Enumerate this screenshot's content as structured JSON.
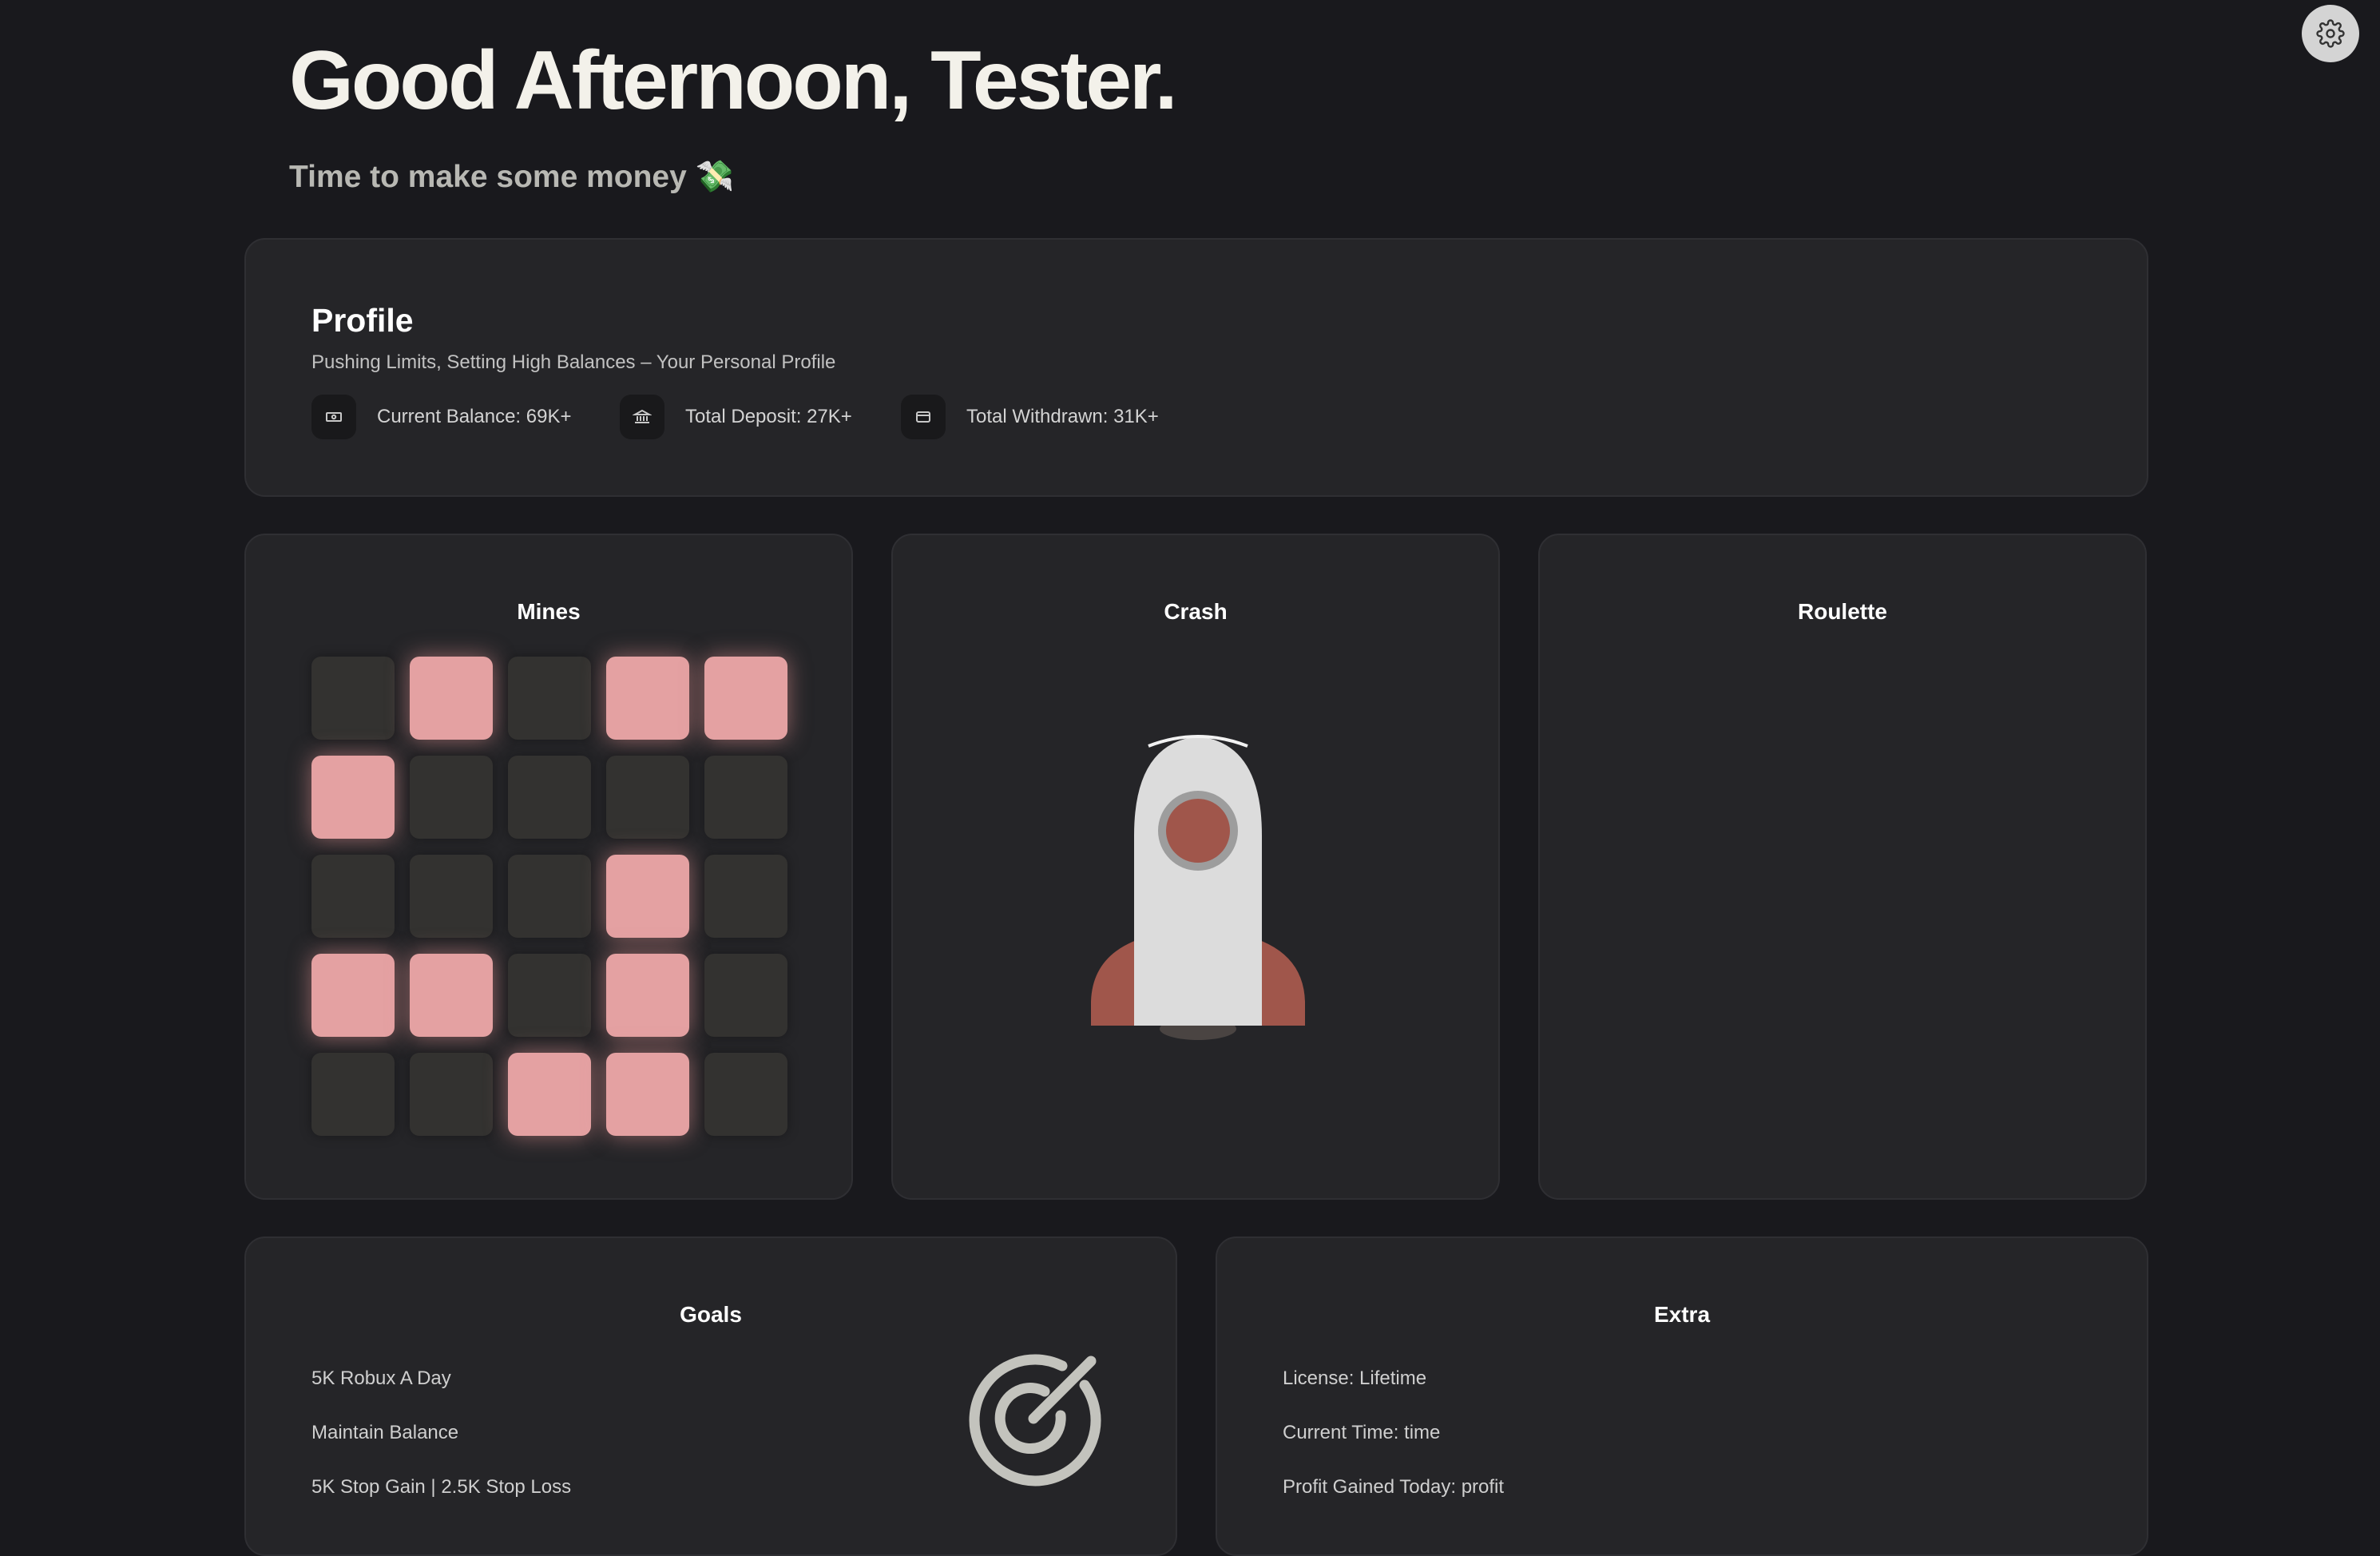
{
  "header": {
    "greeting": "Good Afternoon, Tester.",
    "subtitle": "Time to make some money 💸"
  },
  "settings": {
    "icon": "gear-icon"
  },
  "profile": {
    "title": "Profile",
    "description": "Pushing Limits, Setting High Balances – Your Personal Profile",
    "stats": [
      {
        "icon": "cash-icon",
        "label": "Current Balance: 69K+"
      },
      {
        "icon": "bank-icon",
        "label": "Total Deposit: 27K+"
      },
      {
        "icon": "wallet-icon",
        "label": "Total Withdrawn: 31K+"
      }
    ]
  },
  "games": {
    "mines": {
      "title": "Mines",
      "grid": [
        [
          0,
          1,
          0,
          1,
          1
        ],
        [
          1,
          0,
          0,
          0,
          0
        ],
        [
          0,
          0,
          0,
          1,
          0
        ],
        [
          1,
          1,
          0,
          1,
          0
        ],
        [
          0,
          0,
          1,
          1,
          0
        ]
      ]
    },
    "crash": {
      "title": "Crash",
      "icon": "rocket-icon"
    },
    "roulette": {
      "title": "Roulette"
    }
  },
  "goals": {
    "title": "Goals",
    "items": [
      "5K Robux A Day",
      "Maintain Balance",
      "5K Stop Gain | 2.5K Stop Loss"
    ],
    "icon": "target-icon"
  },
  "extra": {
    "title": "Extra",
    "items": [
      "License: Lifetime",
      "Current Time: time",
      "Profit Gained Today: profit"
    ]
  },
  "colors": {
    "background": "#19191d",
    "card": "#252528",
    "gem_tile": "#e4a1a2",
    "empty_tile": "#333230",
    "rocket_accent": "#a0564b"
  }
}
